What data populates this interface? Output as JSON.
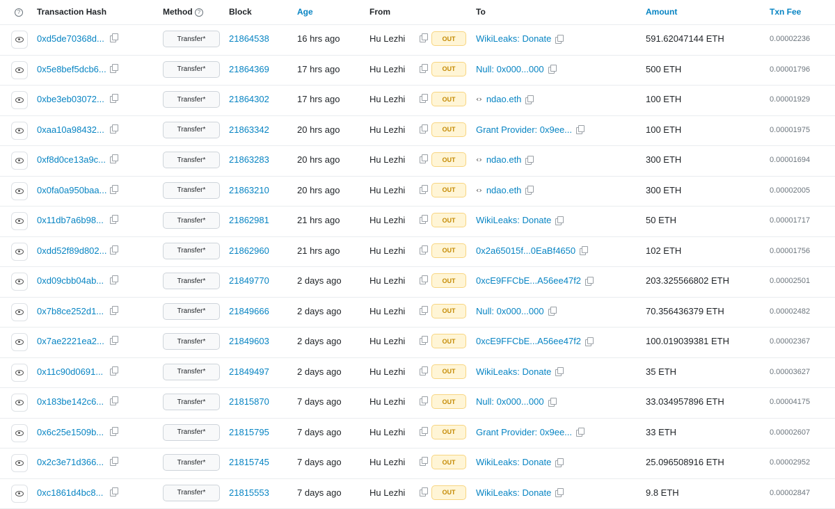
{
  "header": {
    "help_icon": "question-circle-icon",
    "tx_hash": "Transaction Hash",
    "method": "Method",
    "block": "Block",
    "age": "Age",
    "from": "From",
    "to": "To",
    "amount": "Amount",
    "fee": "Txn Fee"
  },
  "rows": [
    {
      "hash": "0xd5de70368d...",
      "method": "Transfer*",
      "block": "21864538",
      "age": "16 hrs ago",
      "from": "Hu Lezhi",
      "dir": "OUT",
      "to": "WikiLeaks: Donate",
      "ens": false,
      "amount": "591.62047144 ETH",
      "fee": "0.00002236"
    },
    {
      "hash": "0x5e8bef5dcb6...",
      "method": "Transfer*",
      "block": "21864369",
      "age": "17 hrs ago",
      "from": "Hu Lezhi",
      "dir": "OUT",
      "to": "Null: 0x000...000",
      "ens": false,
      "amount": "500 ETH",
      "fee": "0.00001796"
    },
    {
      "hash": "0xbe3eb03072...",
      "method": "Transfer*",
      "block": "21864302",
      "age": "17 hrs ago",
      "from": "Hu Lezhi",
      "dir": "OUT",
      "to": "ndao.eth",
      "ens": true,
      "amount": "100 ETH",
      "fee": "0.00001929"
    },
    {
      "hash": "0xaa10a98432...",
      "method": "Transfer*",
      "block": "21863342",
      "age": "20 hrs ago",
      "from": "Hu Lezhi",
      "dir": "OUT",
      "to": "Grant Provider: 0x9ee...",
      "ens": false,
      "amount": "100 ETH",
      "fee": "0.00001975"
    },
    {
      "hash": "0xf8d0ce13a9c...",
      "method": "Transfer*",
      "block": "21863283",
      "age": "20 hrs ago",
      "from": "Hu Lezhi",
      "dir": "OUT",
      "to": "ndao.eth",
      "ens": true,
      "amount": "300 ETH",
      "fee": "0.00001694"
    },
    {
      "hash": "0x0fa0a950baa...",
      "method": "Transfer*",
      "block": "21863210",
      "age": "20 hrs ago",
      "from": "Hu Lezhi",
      "dir": "OUT",
      "to": "ndao.eth",
      "ens": true,
      "amount": "300 ETH",
      "fee": "0.00002005"
    },
    {
      "hash": "0x11db7a6b98...",
      "method": "Transfer*",
      "block": "21862981",
      "age": "21 hrs ago",
      "from": "Hu Lezhi",
      "dir": "OUT",
      "to": "WikiLeaks: Donate",
      "ens": false,
      "amount": "50 ETH",
      "fee": "0.00001717"
    },
    {
      "hash": "0xdd52f89d802...",
      "method": "Transfer*",
      "block": "21862960",
      "age": "21 hrs ago",
      "from": "Hu Lezhi",
      "dir": "OUT",
      "to": "0x2a65015f...0EaBf4650",
      "ens": false,
      "amount": "102 ETH",
      "fee": "0.00001756"
    },
    {
      "hash": "0xd09cbb04ab...",
      "method": "Transfer*",
      "block": "21849770",
      "age": "2 days ago",
      "from": "Hu Lezhi",
      "dir": "OUT",
      "to": "0xcE9FFCbE...A56ee47f2",
      "ens": false,
      "amount": "203.325566802 ETH",
      "fee": "0.00002501"
    },
    {
      "hash": "0x7b8ce252d1...",
      "method": "Transfer*",
      "block": "21849666",
      "age": "2 days ago",
      "from": "Hu Lezhi",
      "dir": "OUT",
      "to": "Null: 0x000...000",
      "ens": false,
      "amount": "70.356436379 ETH",
      "fee": "0.00002482"
    },
    {
      "hash": "0x7ae2221ea2...",
      "method": "Transfer*",
      "block": "21849603",
      "age": "2 days ago",
      "from": "Hu Lezhi",
      "dir": "OUT",
      "to": "0xcE9FFCbE...A56ee47f2",
      "ens": false,
      "amount": "100.019039381 ETH",
      "fee": "0.00002367"
    },
    {
      "hash": "0x11c90d0691...",
      "method": "Transfer*",
      "block": "21849497",
      "age": "2 days ago",
      "from": "Hu Lezhi",
      "dir": "OUT",
      "to": "WikiLeaks: Donate",
      "ens": false,
      "amount": "35 ETH",
      "fee": "0.00003627"
    },
    {
      "hash": "0x183be142c6...",
      "method": "Transfer*",
      "block": "21815870",
      "age": "7 days ago",
      "from": "Hu Lezhi",
      "dir": "OUT",
      "to": "Null: 0x000...000",
      "ens": false,
      "amount": "33.034957896 ETH",
      "fee": "0.00004175"
    },
    {
      "hash": "0x6c25e1509b...",
      "method": "Transfer*",
      "block": "21815795",
      "age": "7 days ago",
      "from": "Hu Lezhi",
      "dir": "OUT",
      "to": "Grant Provider: 0x9ee...",
      "ens": false,
      "amount": "33 ETH",
      "fee": "0.00002607"
    },
    {
      "hash": "0x2c3e71d366...",
      "method": "Transfer*",
      "block": "21815745",
      "age": "7 days ago",
      "from": "Hu Lezhi",
      "dir": "OUT",
      "to": "WikiLeaks: Donate",
      "ens": false,
      "amount": "25.096508916 ETH",
      "fee": "0.00002952"
    },
    {
      "hash": "0xc1861d4bc8...",
      "method": "Transfer*",
      "block": "21815553",
      "age": "7 days ago",
      "from": "Hu Lezhi",
      "dir": "OUT",
      "to": "WikiLeaks: Donate",
      "ens": false,
      "amount": "9.8 ETH",
      "fee": "0.00002847"
    }
  ],
  "colors": {
    "link": "#0784c3",
    "out_badge_bg": "#fff5d6",
    "out_badge_text": "#c48a04"
  }
}
